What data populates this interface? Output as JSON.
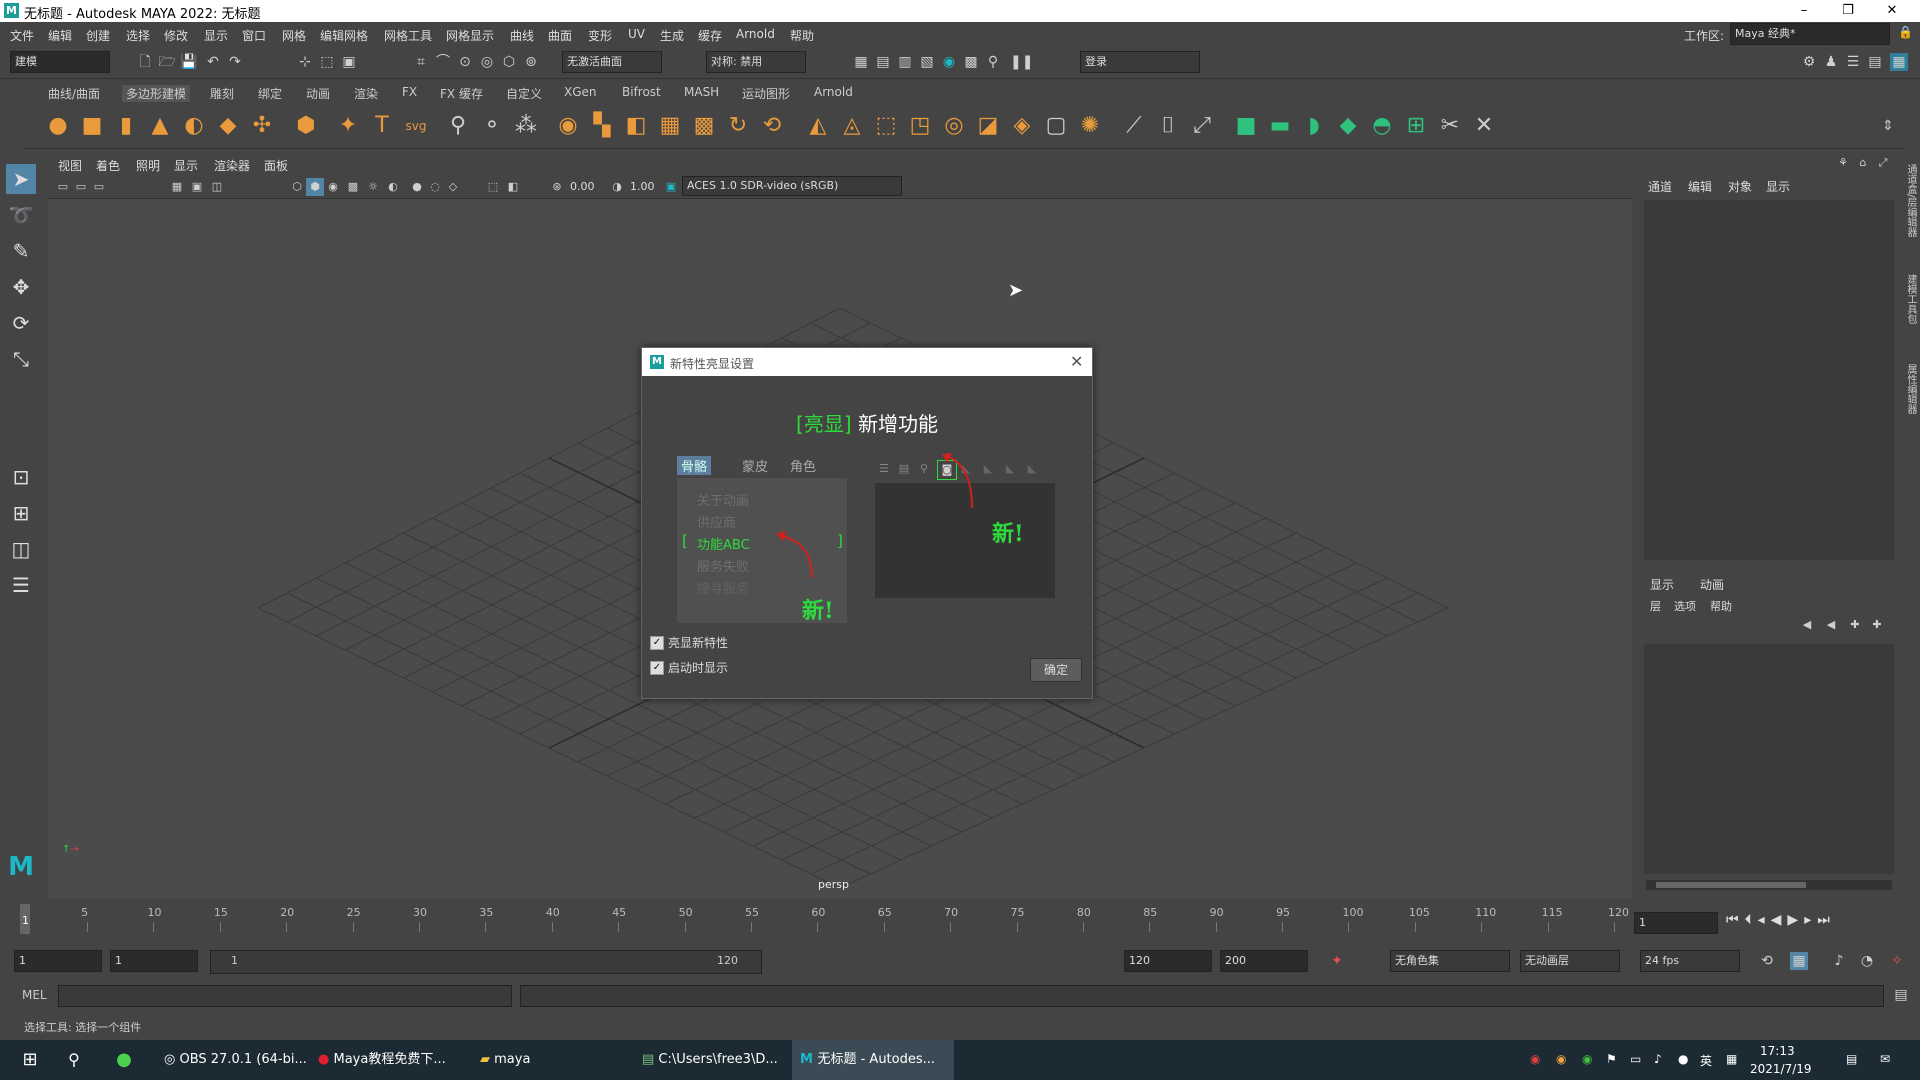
{
  "window": {
    "title": "无标题 - Autodesk MAYA 2022: 无标题",
    "logo": "M",
    "minimize": "–",
    "restore": "❐",
    "close": "✕"
  },
  "menus": [
    "文件",
    "编辑",
    "创建",
    "选择",
    "修改",
    "显示",
    "窗口",
    "网格",
    "编辑网格",
    "网格工具",
    "网格显示",
    "曲线",
    "曲面",
    "变形",
    "UV",
    "生成",
    "缓存",
    "Arnold",
    "帮助"
  ],
  "workspace": {
    "label": "工作区:",
    "value": "Maya 经典*"
  },
  "status": {
    "mode": "建模",
    "live_surface": "无激活曲面",
    "symmetry": "对称: 禁用",
    "login": "登录"
  },
  "shelf_tabs": [
    "曲线/曲面",
    "多边形建模",
    "雕刻",
    "绑定",
    "动画",
    "渲染",
    "FX",
    "FX 缓存",
    "自定义",
    "XGen",
    "Bifrost",
    "MASH",
    "运动图形",
    "Arnold"
  ],
  "shelf_active": "多边形建模",
  "viewport": {
    "menus": [
      "视图",
      "着色",
      "照明",
      "显示",
      "渲染器",
      "面板"
    ],
    "exposure": "0.00",
    "gamma": "1.00",
    "colorspace": "ACES 1.0 SDR-video (sRGB)",
    "camera": "persp"
  },
  "dialog": {
    "title": "新特性亮显设置",
    "headline_highlight": "[亮显]",
    "headline_rest": "新增功能",
    "preview_tabs": [
      "骨骼",
      "蒙皮",
      "角色"
    ],
    "preview_items": [
      "关于动画",
      "供应商",
      "功能ABC",
      "服务失败",
      "搜寻服务"
    ],
    "selected_item": "功能ABC",
    "bracket_left": "[",
    "bracket_right": "]",
    "new_label": "新!",
    "checkbox1": "亮显新特性",
    "checkbox2": "启动时显示",
    "ok": "确定"
  },
  "right_panel": {
    "tabs_top": [
      "通道",
      "编辑",
      "对象",
      "显示"
    ],
    "tabs_bottom": [
      "显示",
      "动画"
    ],
    "sub_menus": [
      "层",
      "选项",
      "帮助"
    ],
    "side_labels": [
      "通道盒/层编辑器",
      "建模工具包",
      "属性编辑器"
    ]
  },
  "timeline": {
    "ticks": [
      "5",
      "10",
      "15",
      "20",
      "25",
      "30",
      "35",
      "40",
      "45",
      "50",
      "55",
      "60",
      "65",
      "70",
      "75",
      "80",
      "85",
      "90",
      "95",
      "100",
      "105",
      "110",
      "115",
      "120"
    ],
    "current": "1",
    "current_field": "1"
  },
  "range": {
    "start": "1",
    "start2": "1",
    "slider_start": "1",
    "slider_end": "120",
    "end": "120",
    "end2": "200",
    "charset": "无角色集",
    "anim_layer": "无动画层",
    "fps": "24 fps"
  },
  "command": {
    "lang": "MEL"
  },
  "help_line": "选择工具: 选择一个组件",
  "taskbar": {
    "items": [
      "OBS 27.0.1 (64-bi...",
      "Maya教程免费下...",
      "maya",
      "C:\\Users\\free3\\D...",
      "无标题 - Autodes..."
    ],
    "time": "17:13",
    "date": "2021/7/19",
    "ime": "英"
  }
}
